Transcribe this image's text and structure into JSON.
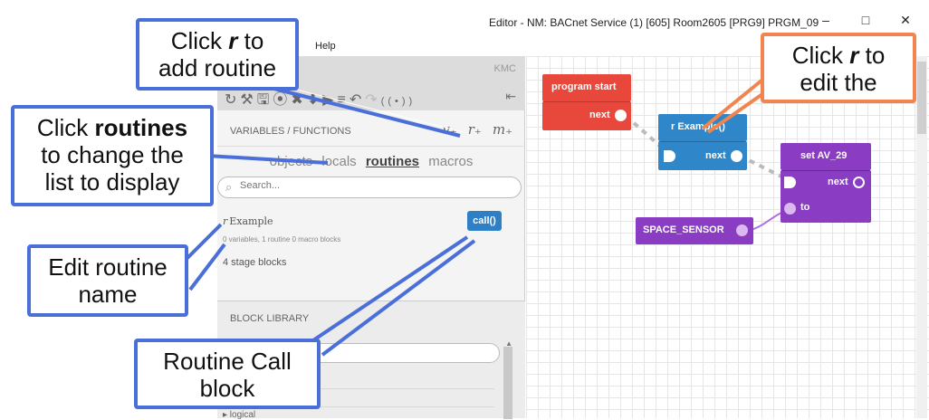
{
  "window": {
    "title": "Editor - NM: BACnet Service (1) [605] Room2605 [PRG9] PRGM_09",
    "minimize": "–",
    "maximize": "□",
    "close": "✕",
    "menu_help": "Help"
  },
  "panel": {
    "brand": "KMC",
    "toolbar_icons": [
      "refresh-icon",
      "hammer-icon",
      "save-icon",
      "stop-icon",
      "delete-icon",
      "download-icon",
      "run-icon",
      "list-icon",
      "undo-icon",
      "redo-icon",
      "broadcast-icon"
    ],
    "collapse": "⇤",
    "variables_header": "VARIABLES / FUNCTIONS",
    "adders": [
      "v₊",
      "r₊",
      "m₊"
    ],
    "tabs": [
      "objects",
      "locals",
      "routines",
      "macros"
    ],
    "active_tab": "routines",
    "search_placeholder": "Search...",
    "routine": {
      "prefix": "r",
      "name": "Example",
      "meta": "0 variables, 1 routine 0 macro blocks",
      "stage_blocks": "4 stage blocks",
      "call_label": "call()"
    },
    "block_library": {
      "title": "BLOCK LIBRARY",
      "logical": "▸ logical"
    }
  },
  "canvas": {
    "blocks": {
      "program_start": {
        "title": "program start",
        "next": "next"
      },
      "example": {
        "title": "r Example()",
        "next": "next"
      },
      "set_av": {
        "title": "set AV_29",
        "next": "next",
        "to": "to"
      },
      "sensor": {
        "title": "SPACE_SENSOR"
      }
    }
  },
  "callouts": {
    "add_routine": {
      "line1a": "Click ",
      "line1b": "r",
      "line1c": " to",
      "line2": "add routine"
    },
    "routines": {
      "line1a": "Click ",
      "line1b": "routines",
      "line2": "to change the",
      "line3": "list to display"
    },
    "edit_name": {
      "line1": "Edit routine",
      "line2": "name"
    },
    "call_block": {
      "line1": "Routine Call",
      "line2": "block"
    },
    "edit_routine": {
      "line1a": "Click ",
      "line1b": "r",
      "line1c": " to",
      "line2": "edit the"
    }
  },
  "colors": {
    "callout_blue": "#4a6fd8",
    "callout_orange": "#f08550",
    "start_block": "#e8473c",
    "routine_block": "#2f86c8",
    "set_block": "#8a3cc2"
  }
}
